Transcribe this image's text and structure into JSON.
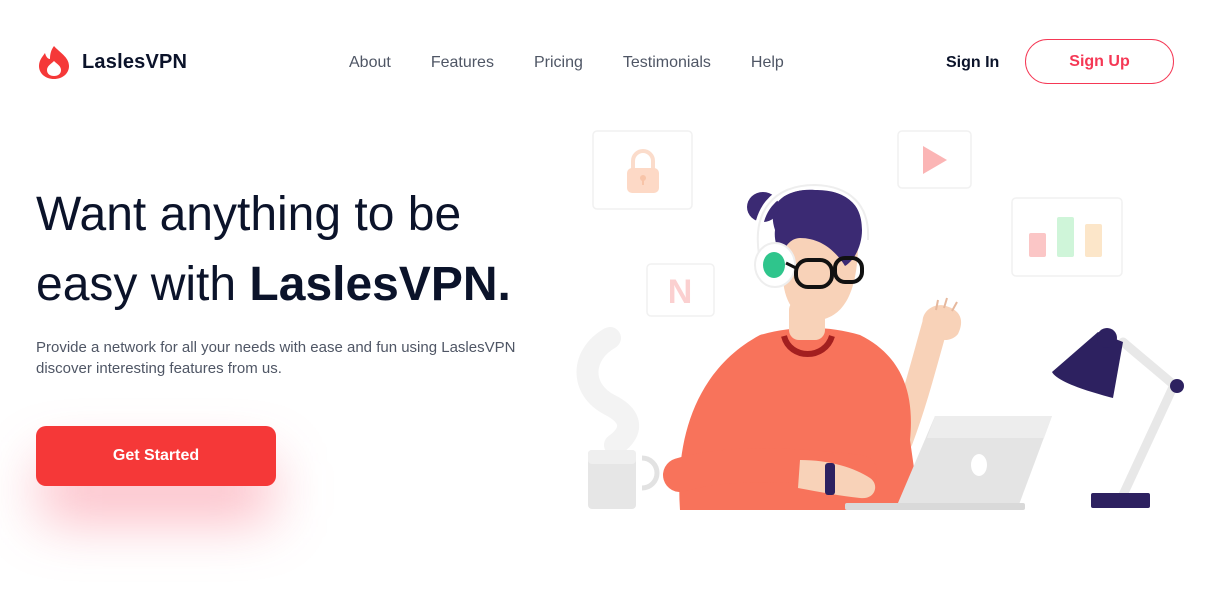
{
  "brand": {
    "name": "LaslesVPN",
    "accent": "#F53838"
  },
  "nav": {
    "items": [
      {
        "label": "About"
      },
      {
        "label": "Features"
      },
      {
        "label": "Pricing"
      },
      {
        "label": "Testimonials"
      },
      {
        "label": "Help"
      }
    ],
    "sign_in": "Sign In",
    "sign_up": "Sign Up"
  },
  "hero": {
    "title_plain": "Want anything to be easy with ",
    "title_bold": "LaslesVPN.",
    "description": "Provide a network for all your needs with ease and fun using LaslesVPN discover interesting features from us.",
    "cta_label": "Get Started"
  },
  "illustration": {
    "icons": [
      "lock-icon",
      "play-icon",
      "netflix-icon",
      "bar-chart-icon",
      "coffee-mug-icon",
      "desk-lamp-icon",
      "laptop-icon",
      "headphones-icon"
    ],
    "netflix_letter": "N"
  }
}
